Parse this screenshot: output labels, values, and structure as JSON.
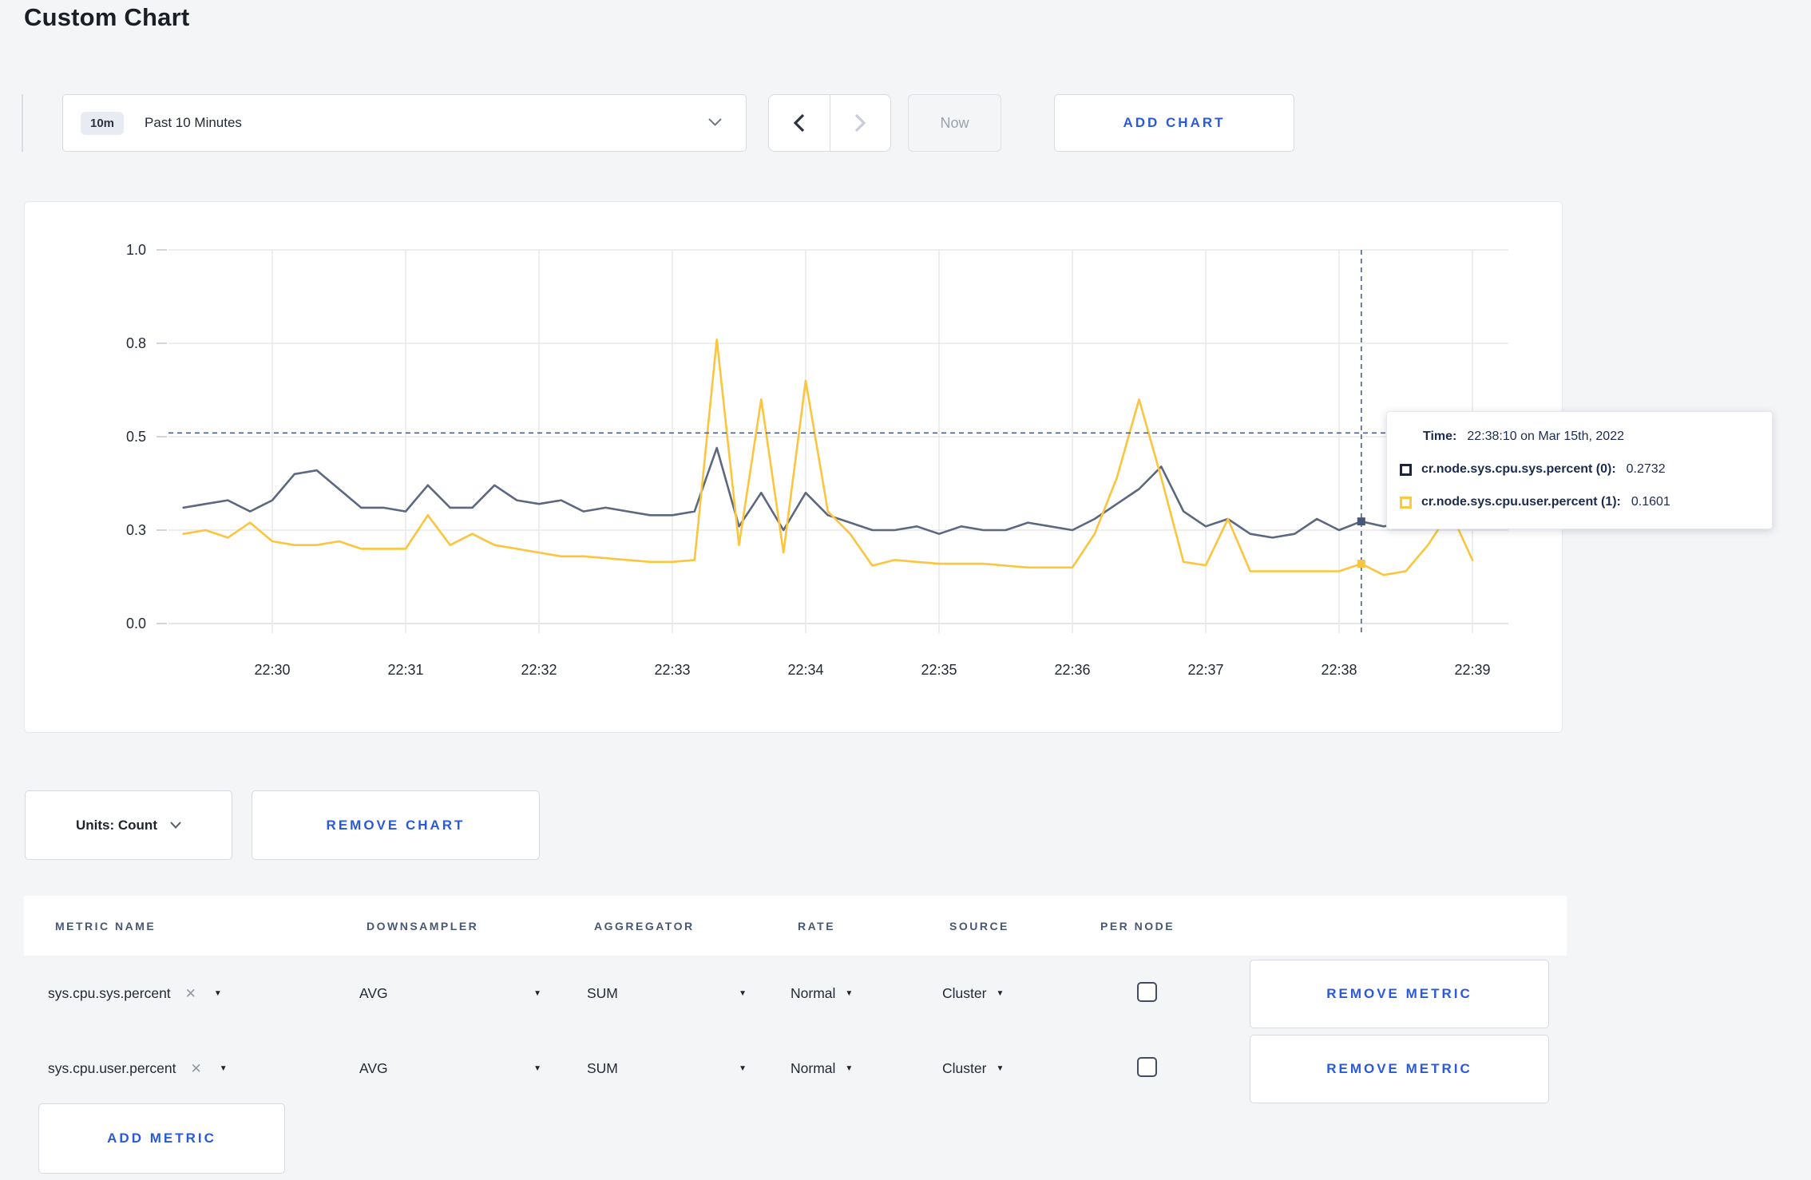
{
  "page": {
    "title": "Custom Chart"
  },
  "toolbar": {
    "time_window": {
      "badge": "10m",
      "label": "Past 10 Minutes"
    },
    "prev_icon": "chevron-left",
    "next_icon": "chevron-right",
    "now_label": "Now",
    "add_chart_label": "ADD CHART"
  },
  "chart": {
    "tooltip": {
      "time_label": "Time:",
      "time_value": "22:38:10 on Mar 15th, 2022",
      "series": [
        {
          "name": "cr.node.sys.cpu.sys.percent (0):",
          "value": "0.2732",
          "swatch_color": "#172347"
        },
        {
          "name": "cr.node.sys.cpu.user.percent (1):",
          "value": "0.1601",
          "swatch_color": "#fdc73e"
        }
      ]
    }
  },
  "chart_data": {
    "type": "line",
    "title": "",
    "xlabel": "",
    "ylabel": "",
    "ylim": [
      0,
      1
    ],
    "grid": true,
    "legend_position": "none",
    "yticks": [
      {
        "value": 0,
        "label": "0.0"
      },
      {
        "value": 0.25,
        "label": "0.3"
      },
      {
        "value": 0.5,
        "label": "0.5"
      },
      {
        "value": 0.75,
        "label": "0.8"
      },
      {
        "value": 1,
        "label": "1.0"
      }
    ],
    "xticks": [
      "22:30",
      "22:31",
      "22:32",
      "22:33",
      "22:34",
      "22:35",
      "22:36",
      "22:37",
      "22:38",
      "22:39"
    ],
    "x": [
      "22:29:20",
      "22:29:30",
      "22:29:40",
      "22:29:50",
      "22:30:00",
      "22:30:10",
      "22:30:20",
      "22:30:30",
      "22:30:40",
      "22:30:50",
      "22:31:00",
      "22:31:10",
      "22:31:20",
      "22:31:30",
      "22:31:40",
      "22:31:50",
      "22:32:00",
      "22:32:10",
      "22:32:20",
      "22:32:30",
      "22:32:40",
      "22:32:50",
      "22:33:00",
      "22:33:10",
      "22:33:20",
      "22:33:30",
      "22:33:40",
      "22:33:50",
      "22:34:00",
      "22:34:10",
      "22:34:20",
      "22:34:30",
      "22:34:40",
      "22:34:50",
      "22:35:00",
      "22:35:10",
      "22:35:20",
      "22:35:30",
      "22:35:40",
      "22:35:50",
      "22:36:00",
      "22:36:10",
      "22:36:20",
      "22:36:30",
      "22:36:40",
      "22:36:50",
      "22:37:00",
      "22:37:10",
      "22:37:20",
      "22:37:30",
      "22:37:40",
      "22:37:50",
      "22:38:00",
      "22:38:10",
      "22:38:20",
      "22:38:30",
      "22:38:40",
      "22:38:50",
      "22:39:00"
    ],
    "series": [
      {
        "name": "cr.node.sys.cpu.sys.percent",
        "color": "#5b6880",
        "values": [
          0.31,
          0.32,
          0.33,
          0.3,
          0.33,
          0.4,
          0.41,
          0.36,
          0.31,
          0.31,
          0.3,
          0.37,
          0.31,
          0.31,
          0.37,
          0.33,
          0.32,
          0.33,
          0.3,
          0.31,
          0.3,
          0.29,
          0.29,
          0.3,
          0.47,
          0.26,
          0.35,
          0.25,
          0.35,
          0.29,
          0.27,
          0.25,
          0.25,
          0.26,
          0.24,
          0.26,
          0.25,
          0.25,
          0.27,
          0.26,
          0.25,
          0.28,
          0.32,
          0.36,
          0.42,
          0.3,
          0.26,
          0.28,
          0.24,
          0.23,
          0.24,
          0.28,
          0.25,
          0.2732,
          0.26,
          0.27,
          0.28,
          0.29,
          0.3
        ]
      },
      {
        "name": "cr.node.sys.cpu.user.percent",
        "color": "#fbc53d",
        "values": [
          0.24,
          0.25,
          0.23,
          0.27,
          0.22,
          0.21,
          0.21,
          0.22,
          0.2,
          0.2,
          0.2,
          0.29,
          0.21,
          0.24,
          0.21,
          0.2,
          0.19,
          0.18,
          0.18,
          0.175,
          0.17,
          0.165,
          0.165,
          0.17,
          0.76,
          0.21,
          0.6,
          0.19,
          0.65,
          0.3,
          0.24,
          0.155,
          0.17,
          0.165,
          0.16,
          0.16,
          0.16,
          0.155,
          0.15,
          0.15,
          0.15,
          0.24,
          0.39,
          0.6,
          0.39,
          0.165,
          0.156,
          0.28,
          0.14,
          0.14,
          0.14,
          0.14,
          0.14,
          0.1601,
          0.13,
          0.14,
          0.21,
          0.3,
          0.17
        ]
      }
    ],
    "crosshair": {
      "time": "22:38:10",
      "mouse_y_value": 0.51,
      "point_values": [
        0.2732,
        0.1601
      ]
    }
  },
  "units": {
    "label": "Units: Count"
  },
  "remove_chart_label": "REMOVE CHART",
  "metrics": {
    "headers": [
      "METRIC NAME",
      "DOWNSAMPLER",
      "AGGREGATOR",
      "RATE",
      "SOURCE",
      "PER NODE"
    ],
    "rows": [
      {
        "name": "sys.cpu.sys.percent",
        "downsampler": "AVG",
        "aggregator": "SUM",
        "rate": "Normal",
        "source": "Cluster",
        "per_node_checked": false,
        "remove_label": "REMOVE METRIC"
      },
      {
        "name": "sys.cpu.user.percent",
        "downsampler": "AVG",
        "aggregator": "SUM",
        "rate": "Normal",
        "source": "Cluster",
        "per_node_checked": false,
        "remove_label": "REMOVE METRIC"
      }
    ],
    "add_metric_label": "ADD METRIC"
  }
}
